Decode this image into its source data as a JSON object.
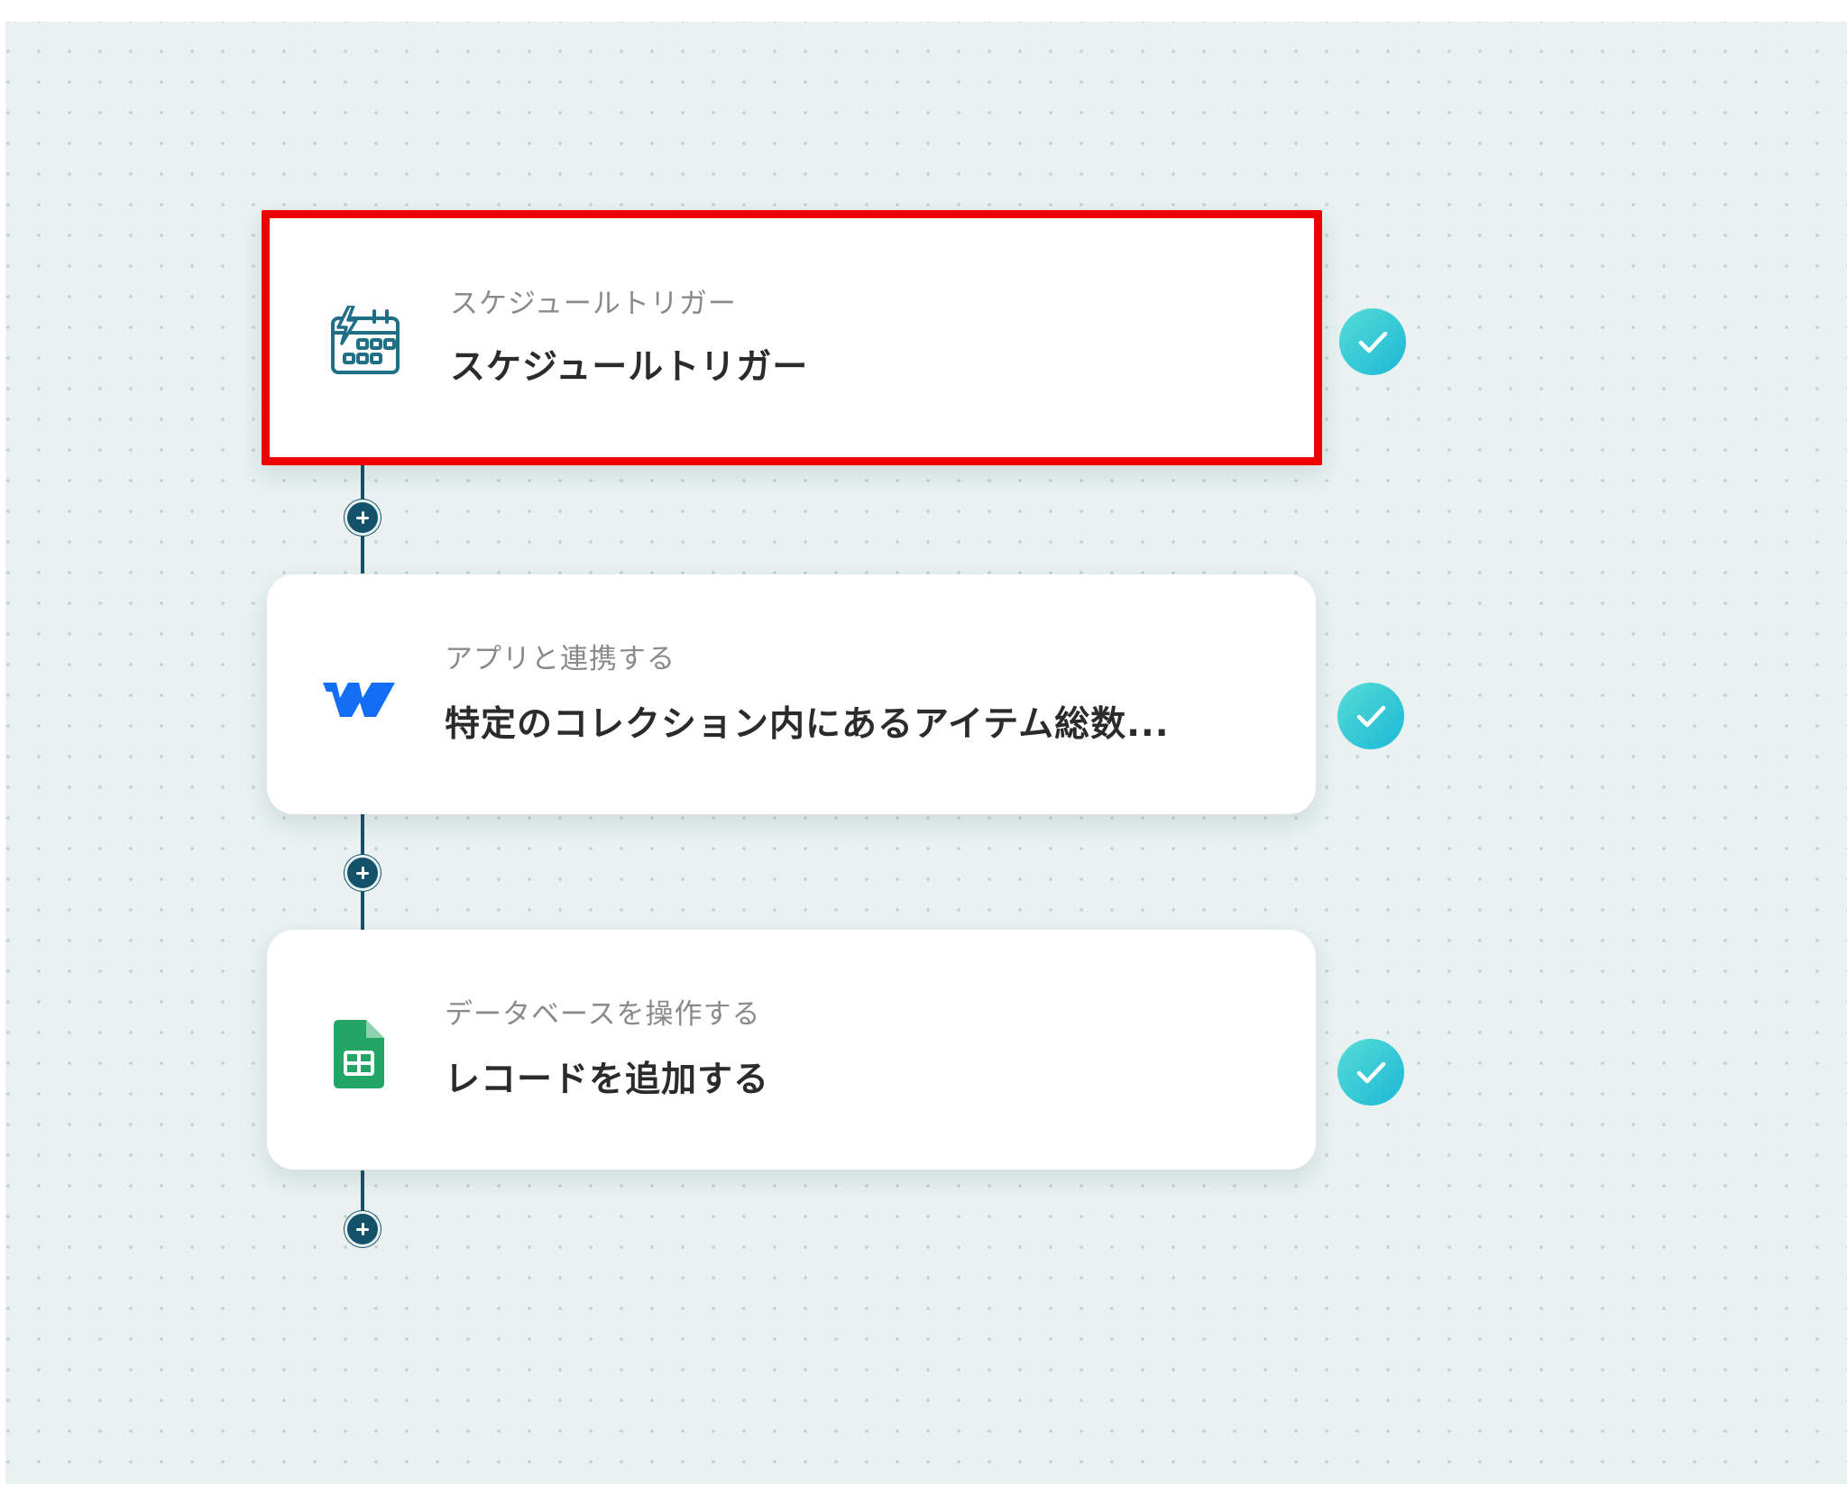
{
  "flow": {
    "steps": [
      {
        "category": "スケジュールトリガー",
        "title": "スケジュールトリガー",
        "icon": "schedule-calendar-lightning-icon",
        "status": "completed",
        "selected": true
      },
      {
        "category": "アプリと連携する",
        "title": "特定のコレクション内にあるアイテム総数...",
        "icon": "webflow-logo-icon",
        "status": "completed",
        "selected": false
      },
      {
        "category": "データベースを操作する",
        "title": "レコードを追加する",
        "icon": "google-sheets-icon",
        "status": "completed",
        "selected": false
      }
    ]
  },
  "colors": {
    "canvas_background": "#e9f1f1",
    "connector": "#14526a",
    "highlight_border": "#ee0000",
    "check_gradient_start": "#56dcd6",
    "check_gradient_end": "#1cb8d6",
    "webflow_blue": "#146ef5",
    "sheets_green": "#23a566"
  }
}
